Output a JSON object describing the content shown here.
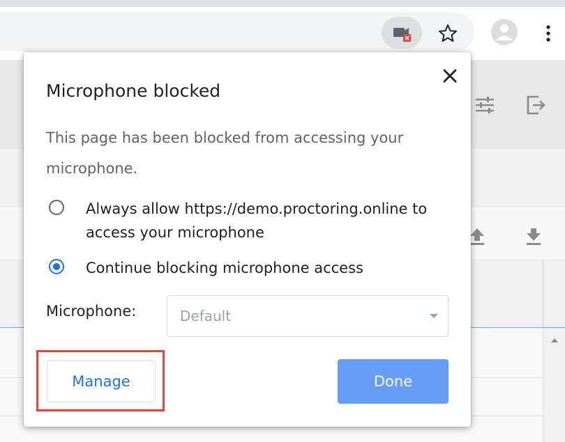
{
  "toolbar": {
    "icons": [
      "camera-blocked-icon",
      "star-icon",
      "profile-avatar-icon",
      "more-menu-icon"
    ]
  },
  "background": {
    "icons": [
      "tune-icon",
      "exit-icon",
      "upload-icon",
      "download-icon",
      "scroll-up-arrow-icon"
    ]
  },
  "dialog": {
    "title": "Microphone blocked",
    "description": "This page has been blocked from accessing your microphone.",
    "options": [
      {
        "label": "Always allow https://demo.proctoring.online to access your microphone",
        "selected": false
      },
      {
        "label": "Continue blocking microphone access",
        "selected": true
      }
    ],
    "device_label": "Microphone:",
    "device_value": "Default",
    "manage_label": "Manage",
    "done_label": "Done"
  },
  "colors": {
    "accent": "#1a73e8",
    "done_button": "#669df6",
    "highlight": "#ea4335"
  }
}
